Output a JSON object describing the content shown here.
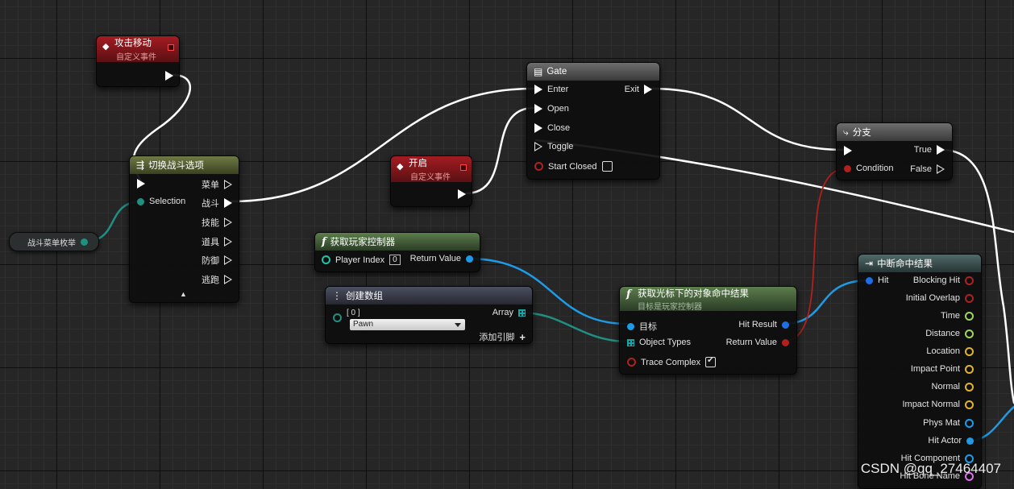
{
  "colors": {
    "exec": "#ffffff",
    "object": "#1e9be6",
    "struct": "#1f8f82",
    "bool": "#b1201c",
    "float": "#9ed65b",
    "vector": "#e3b425",
    "string": "#d873e8"
  },
  "nodes": {
    "attack_move": {
      "title": "攻击移动",
      "subtitle": "自定义事件"
    },
    "open_event": {
      "title": "开启",
      "subtitle": "自定义事件"
    },
    "gate": {
      "title": "Gate",
      "enter": "Enter",
      "open": "Open",
      "close": "Close",
      "toggle": "Toggle",
      "start_closed": "Start Closed",
      "exit": "Exit"
    },
    "branch": {
      "title": "分支",
      "condition": "Condition",
      "true_label": "True",
      "false_label": "False"
    },
    "switch": {
      "title": "切换战斗选项",
      "selection": "Selection",
      "out1": "菜单",
      "out2": "战斗",
      "out3": "技能",
      "out4": "道具",
      "out5": "防御",
      "out6": "逃跑"
    },
    "enum_var": {
      "label": "战斗菜单枚举"
    },
    "get_player_controller": {
      "title": "获取玩家控制器",
      "player_index_label": "Player Index",
      "player_index_value": "0",
      "return_value": "Return Value"
    },
    "make_array": {
      "title": "创建数组",
      "index0": "[ 0 ]",
      "pawn_option": "Pawn",
      "array": "Array",
      "add_pin": "添加引脚"
    },
    "get_hit_result": {
      "title": "获取光标下的对象命中结果",
      "subtitle": "目标是玩家控制器",
      "target": "目标",
      "object_types": "Object Types",
      "trace_complex": "Trace Complex",
      "hit_result": "Hit Result",
      "return_value": "Return Value"
    },
    "break_hit": {
      "title": "中断命中结果",
      "hit": "Hit",
      "blocking_hit": "Blocking Hit",
      "initial_overlap": "Initial Overlap",
      "time": "Time",
      "distance": "Distance",
      "location": "Location",
      "impact_point": "Impact Point",
      "normal": "Normal",
      "impact_normal": "Impact Normal",
      "phys_mat": "Phys Mat",
      "hit_actor": "Hit Actor",
      "hit_component": "Hit Component",
      "hit_bone_name": "Hit Bone Name"
    }
  },
  "watermark": "CSDN @qq_27464407"
}
